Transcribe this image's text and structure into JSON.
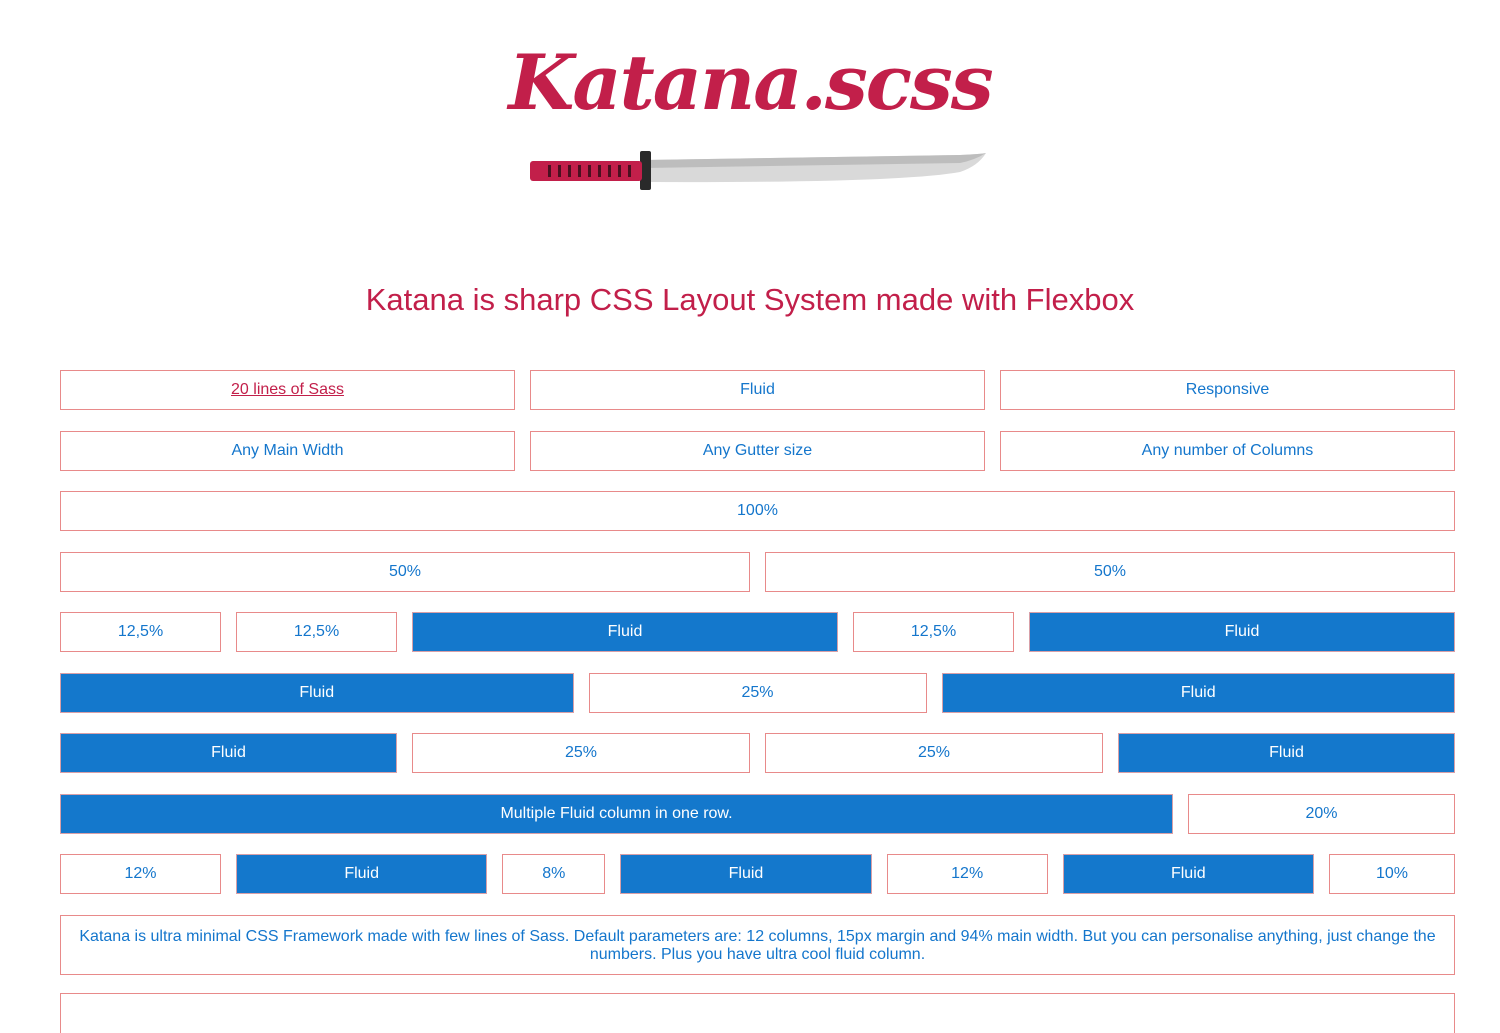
{
  "header": {
    "logo_text": "Katana.scss",
    "tagline": "Katana is sharp CSS Layout System made with Flexbox"
  },
  "colors": {
    "brand": "#c21f4a",
    "accent_blue": "#1478cc",
    "border": "#e88a8a"
  },
  "rows": [
    [
      "20 lines of Sass",
      "Fluid",
      "Responsive"
    ],
    [
      "Any Main Width",
      "Any Gutter size",
      "Any number of Columns"
    ],
    [
      "100%"
    ],
    [
      "50%",
      "50%"
    ],
    [
      "12,5%",
      "12,5%",
      "Fluid",
      "12,5%",
      "Fluid"
    ],
    [
      "Fluid",
      "25%",
      "Fluid"
    ],
    [
      "Fluid",
      "25%",
      "25%",
      "Fluid"
    ],
    [
      "Multiple Fluid column in one row.",
      "20%"
    ],
    [
      "12%",
      "Fluid",
      "8%",
      "Fluid",
      "12%",
      "Fluid",
      "10%"
    ]
  ],
  "description": "Katana is ultra minimal CSS Framework made with few lines of Sass. Default parameters are: 12 columns, 15px margin and 94% main width. But you can personalise anything, just change the numbers. Plus you have ultra cool fluid column."
}
